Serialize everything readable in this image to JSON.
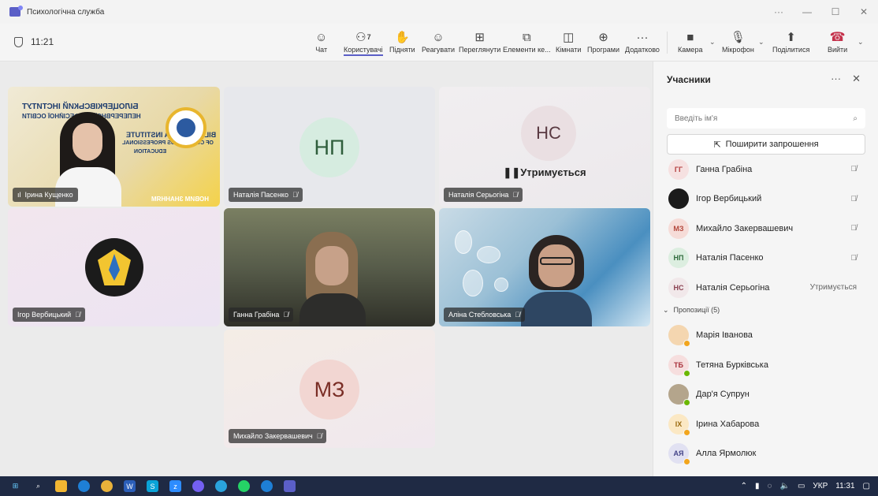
{
  "window": {
    "title": "Психологічна служба",
    "controls": [
      "···",
      "—",
      "☐",
      "✕"
    ]
  },
  "toolbar": {
    "timer": "11:21",
    "buttons": {
      "chat": "Чат",
      "people": "Користувачі",
      "people_count": "7",
      "raise": "Підняти",
      "react": "Реагувати",
      "view": "Переглянути",
      "elements": "Елементи ке...",
      "rooms": "Кімнати",
      "apps": "Програми",
      "more": "Додатково",
      "camera": "Камера",
      "mic": "Мікрофон",
      "share": "Поділитися",
      "leave": "Вийти"
    }
  },
  "tiles": [
    {
      "name": "Ірина Кущенко",
      "type": "video"
    },
    {
      "name": "Наталія Пасенко",
      "initials": "НП",
      "type": "avatar"
    },
    {
      "name": "Наталія Серьогіна",
      "initials": "НС",
      "type": "avatar",
      "status": "Утримується"
    },
    {
      "name": "Ігор Вербицький",
      "type": "image"
    },
    {
      "name": "Ганна Грабіна",
      "type": "video"
    },
    {
      "name": "Аліна Стебловська",
      "type": "video"
    },
    {
      "name": "Михайло Закервашевич",
      "initials": "МЗ",
      "type": "avatar"
    }
  ],
  "banner_text": {
    "line1": "БІЛОЦЕРКІВСЬКИЙ ІНСТИТУТ",
    "line2": "НЕПЕРЕРВНОЇ ПРОФЕСІЙНОЇ ОСВІТИ",
    "line3": "BILA TSERKVA INSTITUTE",
    "line4": "OF CONTINUOUS PROFESSIONAL",
    "line5": "EDUCATION",
    "line6": "НОВИМ ЗНАННЯМ"
  },
  "panel": {
    "title": "Учасники",
    "search_placeholder": "Введіть ім'я",
    "invite": "Поширити запрошення",
    "participants": [
      {
        "initials": "ГГ",
        "name": "Ганна Грабіна",
        "right": "mic-off",
        "color": "#f6e1e1",
        "fg": "#b33c3c"
      },
      {
        "initials": "",
        "name": "Ігор Вербицький",
        "right": "mic-off",
        "color": "#1b1b1b",
        "fg": "#f2c530"
      },
      {
        "initials": "МЗ",
        "name": "Михайло Закервашевич",
        "right": "mic-off",
        "color": "#f6dcd8",
        "fg": "#b3473c"
      },
      {
        "initials": "НП",
        "name": "Наталія Пасенко",
        "right": "mic-off",
        "color": "#dceee0",
        "fg": "#2f6b3c"
      },
      {
        "initials": "НС",
        "name": "Наталія Серьогіна",
        "right": "Утримується",
        "color": "#f1e8ea",
        "fg": "#8a4050"
      }
    ],
    "suggestions_label": "Пропозиції (5)",
    "suggestions": [
      {
        "initials": "",
        "name": "Марія Іванова",
        "color": "#f4d6b0",
        "presence": "#f2a51c"
      },
      {
        "initials": "ТБ",
        "name": "Тетяна Бурківська",
        "color": "#f6dede",
        "fg": "#a8323c",
        "presence": "#6bb700"
      },
      {
        "initials": "",
        "name": "Дар'я Супрун",
        "color": "#b4a58c",
        "presence": "#6bb700"
      },
      {
        "initials": "ІХ",
        "name": "Ірина Хабарова",
        "color": "#fbe8c4",
        "fg": "#9a6a10",
        "presence": "#f2a51c"
      },
      {
        "initials": "АЯ",
        "name": "Алла Ярмолюк",
        "color": "#e1e1f2",
        "fg": "#444488",
        "presence": "#f2a51c"
      }
    ]
  },
  "taskbar": {
    "lang": "УКР",
    "time": "11:31"
  }
}
